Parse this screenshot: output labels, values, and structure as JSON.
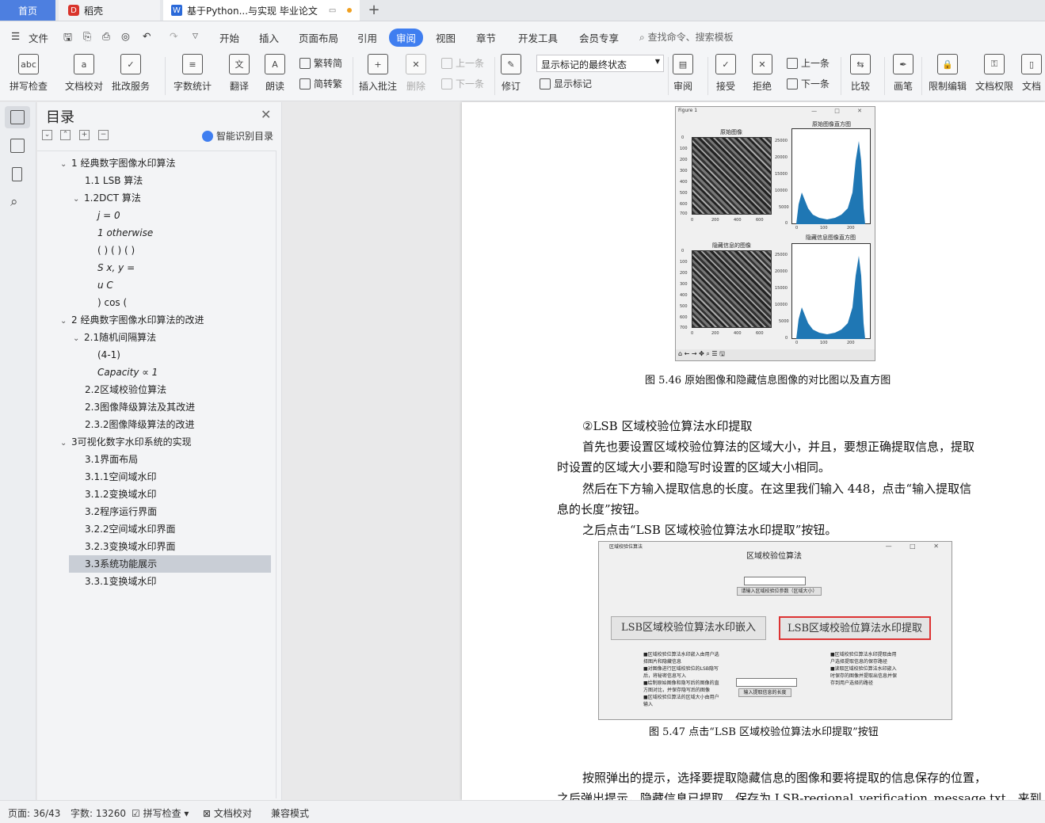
{
  "tabs": {
    "home": "首页",
    "shell": "稻壳",
    "doc": "基于Python...与实现 毕业论文"
  },
  "menu": {
    "file": "文件",
    "items": [
      "开始",
      "插入",
      "页面布局",
      "引用",
      "审阅",
      "视图",
      "章节",
      "开发工具",
      "会员专享"
    ],
    "search": "查找命令、搜索模板"
  },
  "ribbon": {
    "spell": "拼写检查",
    "proof": "文档校对",
    "approve": "批改服务",
    "wordcount": "字数统计",
    "translate": "翻译",
    "read": "朗读",
    "trad": "繁转简",
    "simp": "简转繁",
    "insert_comment": "插入批注",
    "delete": "删除",
    "prev": "上一条",
    "next": "下一条",
    "revise": "修订",
    "markup_state": "显示标记的最终状态",
    "show_markup": "显示标记",
    "review": "审阅",
    "accept": "接受",
    "reject": "拒绝",
    "prev2": "上一条",
    "next2": "下一条",
    "compare": "比较",
    "pen": "画笔",
    "restrict": "限制编辑",
    "doc_perm": "文档权限",
    "doc_more": "文档"
  },
  "toc": {
    "title": "目录",
    "smart": "智能识别目录",
    "items": [
      "1 经典数字图像水印算法",
      "1.1 LSB 算法",
      "1.2DCT 算法",
      "j = 0",
      "1 otherwise",
      "(  )  (  )  (  )",
      "S x, y =",
      "u C",
      ") cos (",
      "2 经典数字图像水印算法的改进",
      "2.1随机间隔算法",
      "(4-1)",
      "Capacity  ∝  1",
      "2.2区域校验位算法",
      "2.3图像降级算法及其改进",
      "2.3.2图像降级算法的改进",
      "3可视化数字水印系统的实现",
      "3.1界面布局",
      "3.1.1空间域水印",
      "3.1.2变换域水印",
      "3.2程序运行界面",
      "3.2.2空间域水印界面",
      "3.2.3变换域水印界面",
      "3.3系统功能展示",
      "3.3.1变换域水印"
    ]
  },
  "figure1": {
    "window_title": "Figure 1",
    "orig_title": "原始图像",
    "orig_hist_title": "原始图像直方图",
    "hidden_title": "隐藏信息的图像",
    "hidden_hist_title": "隐藏信息图像直方图",
    "img_yticks": [
      "0",
      "100",
      "200",
      "300",
      "400",
      "500",
      "600",
      "700"
    ],
    "img_xticks": [
      "0",
      "200",
      "400",
      "600"
    ],
    "hist_yticks": [
      "25000",
      "20000",
      "15000",
      "10000",
      "5000",
      "0"
    ],
    "hist_xticks": [
      "0",
      "100",
      "200"
    ],
    "caption": "图 5.46    原始图像和隐藏信息图像的对比图以及直方图"
  },
  "body": {
    "heading": "②LSB 区域校验位算法水印提取",
    "p1a": "首先也要设置区域校验位算法的区域大小，并且，要想正确提取信息，提取",
    "p1b": "时设置的区域大小要和隐写时设置的区域大小相同。",
    "p2a": "然后在下方输入提取信息的长度。在这里我们输入  448，点击“输入提取信",
    "p2b": "息的长度”按钮。",
    "p3": "之后点击“LSB 区域校验位算法水印提取”按钮。",
    "p4a": "按照弹出的提示，选择要提取隐藏信息的图像和要将提取的信息保存的位置，",
    "p4b": "之后弹出提示，隐藏信息已提取，保存为 LSB-regional_verification_message.txt，来到"
  },
  "figure2": {
    "window_title": "区域校验位算法",
    "heading": "区域校验位算法",
    "param_btn": "请输入区域校验位参数（区域大小）",
    "embed_btn": "LSB区域校验位算法水印嵌入",
    "extract_btn": "LSB区域校验位算法水印提取",
    "left_notes": "■区域校验位算法水印嵌入由用户选择图片和隐藏信息\n■对图像进行区域校验位的LSB隐写后，将秘密信息写入\n■绘制原始图像和隐写后的图像的直方图对比，并保存隐写后的图像\n■区域校验位算法的区域大小由用户输入",
    "right_notes": "■区域校验位算法水印提取由用户选择提取信息的保存路径\n■读取区域校验位算法水印嵌入时保存的图像并提取出信息并保存到用户选择的路径",
    "length_btn": "输入提取信息的长度",
    "caption": "图 5.47    点击“LSB 区域校验位算法水印提取”按钮"
  },
  "status": {
    "page": "页面: 36/43",
    "words": "字数: 13260",
    "spell": "拼写检查",
    "proof": "文档校对",
    "compat": "兼容模式"
  },
  "colors": {
    "accent": "#3f7ef0",
    "hist": "#1f77b4",
    "highlight": "#d33333"
  }
}
